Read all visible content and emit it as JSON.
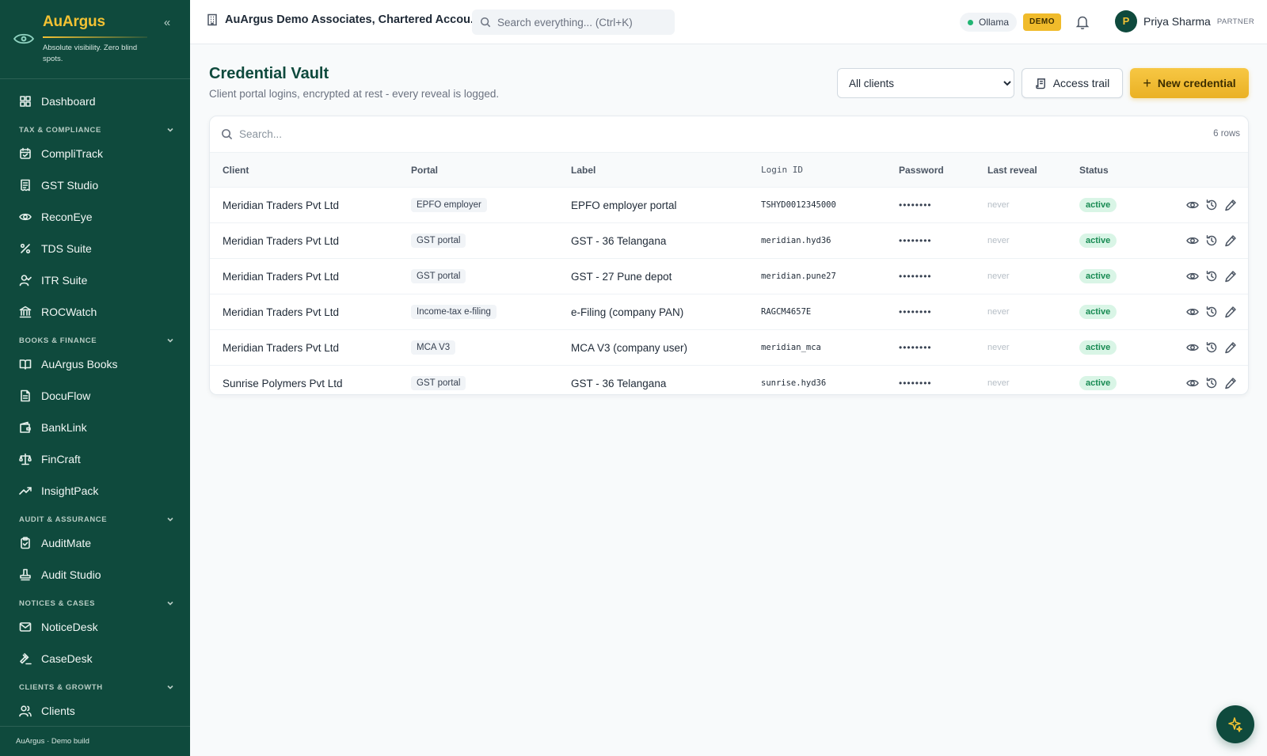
{
  "brand": {
    "name": "AuArgus",
    "tagline": "Absolute visibility. Zero blind spots.",
    "accent": "#f3c233",
    "sidebar_bg": "#0f4a3d"
  },
  "sidebar": {
    "items": [
      {
        "label": "Dashboard",
        "icon": "dashboard-icon"
      },
      {
        "section": "TAX & COMPLIANCE"
      },
      {
        "label": "CompliTrack",
        "icon": "calendar-check-icon"
      },
      {
        "label": "GST Studio",
        "icon": "receipt-icon"
      },
      {
        "label": "ReconEye",
        "icon": "eye-icon"
      },
      {
        "label": "TDS Suite",
        "icon": "percent-icon"
      },
      {
        "label": "ITR Suite",
        "icon": "user-check-icon"
      },
      {
        "label": "ROCWatch",
        "icon": "landmark-icon"
      },
      {
        "section": "BOOKS & FINANCE"
      },
      {
        "label": "AuArgus Books",
        "icon": "book-open-icon"
      },
      {
        "label": "DocuFlow",
        "icon": "file-text-icon"
      },
      {
        "label": "BankLink",
        "icon": "wallet-icon"
      },
      {
        "label": "FinCraft",
        "icon": "scale-icon"
      },
      {
        "label": "InsightPack",
        "icon": "trending-up-icon"
      },
      {
        "section": "AUDIT & ASSURANCE"
      },
      {
        "label": "AuditMate",
        "icon": "clipboard-check-icon"
      },
      {
        "label": "Audit Studio",
        "icon": "stamp-icon"
      },
      {
        "section": "NOTICES & CASES"
      },
      {
        "label": "NoticeDesk",
        "icon": "mail-icon"
      },
      {
        "label": "CaseDesk",
        "icon": "gavel-icon"
      },
      {
        "section": "CLIENTS & GROWTH"
      },
      {
        "label": "Clients",
        "icon": "users-icon"
      }
    ],
    "footer": "AuArgus · Demo build"
  },
  "topbar": {
    "org": "AuArgus Demo Associates, Chartered Accou...",
    "search_placeholder": "Search everything... (Ctrl+K)",
    "model_status": "Ollama",
    "model_status_color": "#22b573",
    "demo_badge": "DEMO",
    "user": {
      "initial": "P",
      "name": "Priya Sharma",
      "role": "PARTNER"
    }
  },
  "page": {
    "title": "Credential Vault",
    "subtitle": "Client portal logins, encrypted at rest - every reveal is logged.",
    "client_filter": {
      "selected": "All clients"
    },
    "access_trail_label": "Access trail",
    "new_credential_label": "New credential"
  },
  "table": {
    "search_placeholder": "Search...",
    "row_count": "6 rows",
    "headers": {
      "client": "Client",
      "portal": "Portal",
      "label": "Label",
      "login": "Login ID",
      "password": "Password",
      "last_reveal": "Last reveal",
      "status": "Status"
    },
    "rows": [
      {
        "client": "Meridian Traders Pvt Ltd",
        "portal": "EPFO employer",
        "label": "EPFO employer portal",
        "login": "TSHYD0012345000",
        "password": "••••••••",
        "last_reveal": "never",
        "status": "active"
      },
      {
        "client": "Meridian Traders Pvt Ltd",
        "portal": "GST portal",
        "label": "GST - 36 Telangana",
        "login": "meridian.hyd36",
        "password": "••••••••",
        "last_reveal": "never",
        "status": "active"
      },
      {
        "client": "Meridian Traders Pvt Ltd",
        "portal": "GST portal",
        "label": "GST - 27 Pune depot",
        "login": "meridian.pune27",
        "password": "••••••••",
        "last_reveal": "never",
        "status": "active"
      },
      {
        "client": "Meridian Traders Pvt Ltd",
        "portal": "Income-tax e-filing",
        "label": "e-Filing (company PAN)",
        "login": "RAGCM4657E",
        "password": "••••••••",
        "last_reveal": "never",
        "status": "active"
      },
      {
        "client": "Meridian Traders Pvt Ltd",
        "portal": "MCA V3",
        "label": "MCA V3 (company user)",
        "login": "meridian_mca",
        "password": "••••••••",
        "last_reveal": "never",
        "status": "active"
      },
      {
        "client": "Sunrise Polymers Pvt Ltd",
        "portal": "GST portal",
        "label": "GST - 36 Telangana",
        "login": "sunrise.hyd36",
        "password": "••••••••",
        "last_reveal": "never",
        "status": "active"
      }
    ],
    "row_actions": [
      "reveal-eye-icon",
      "history-icon",
      "edit-pencil-icon"
    ],
    "status_color": "#178a52"
  },
  "fab": {
    "icon": "sparkle-icon"
  }
}
